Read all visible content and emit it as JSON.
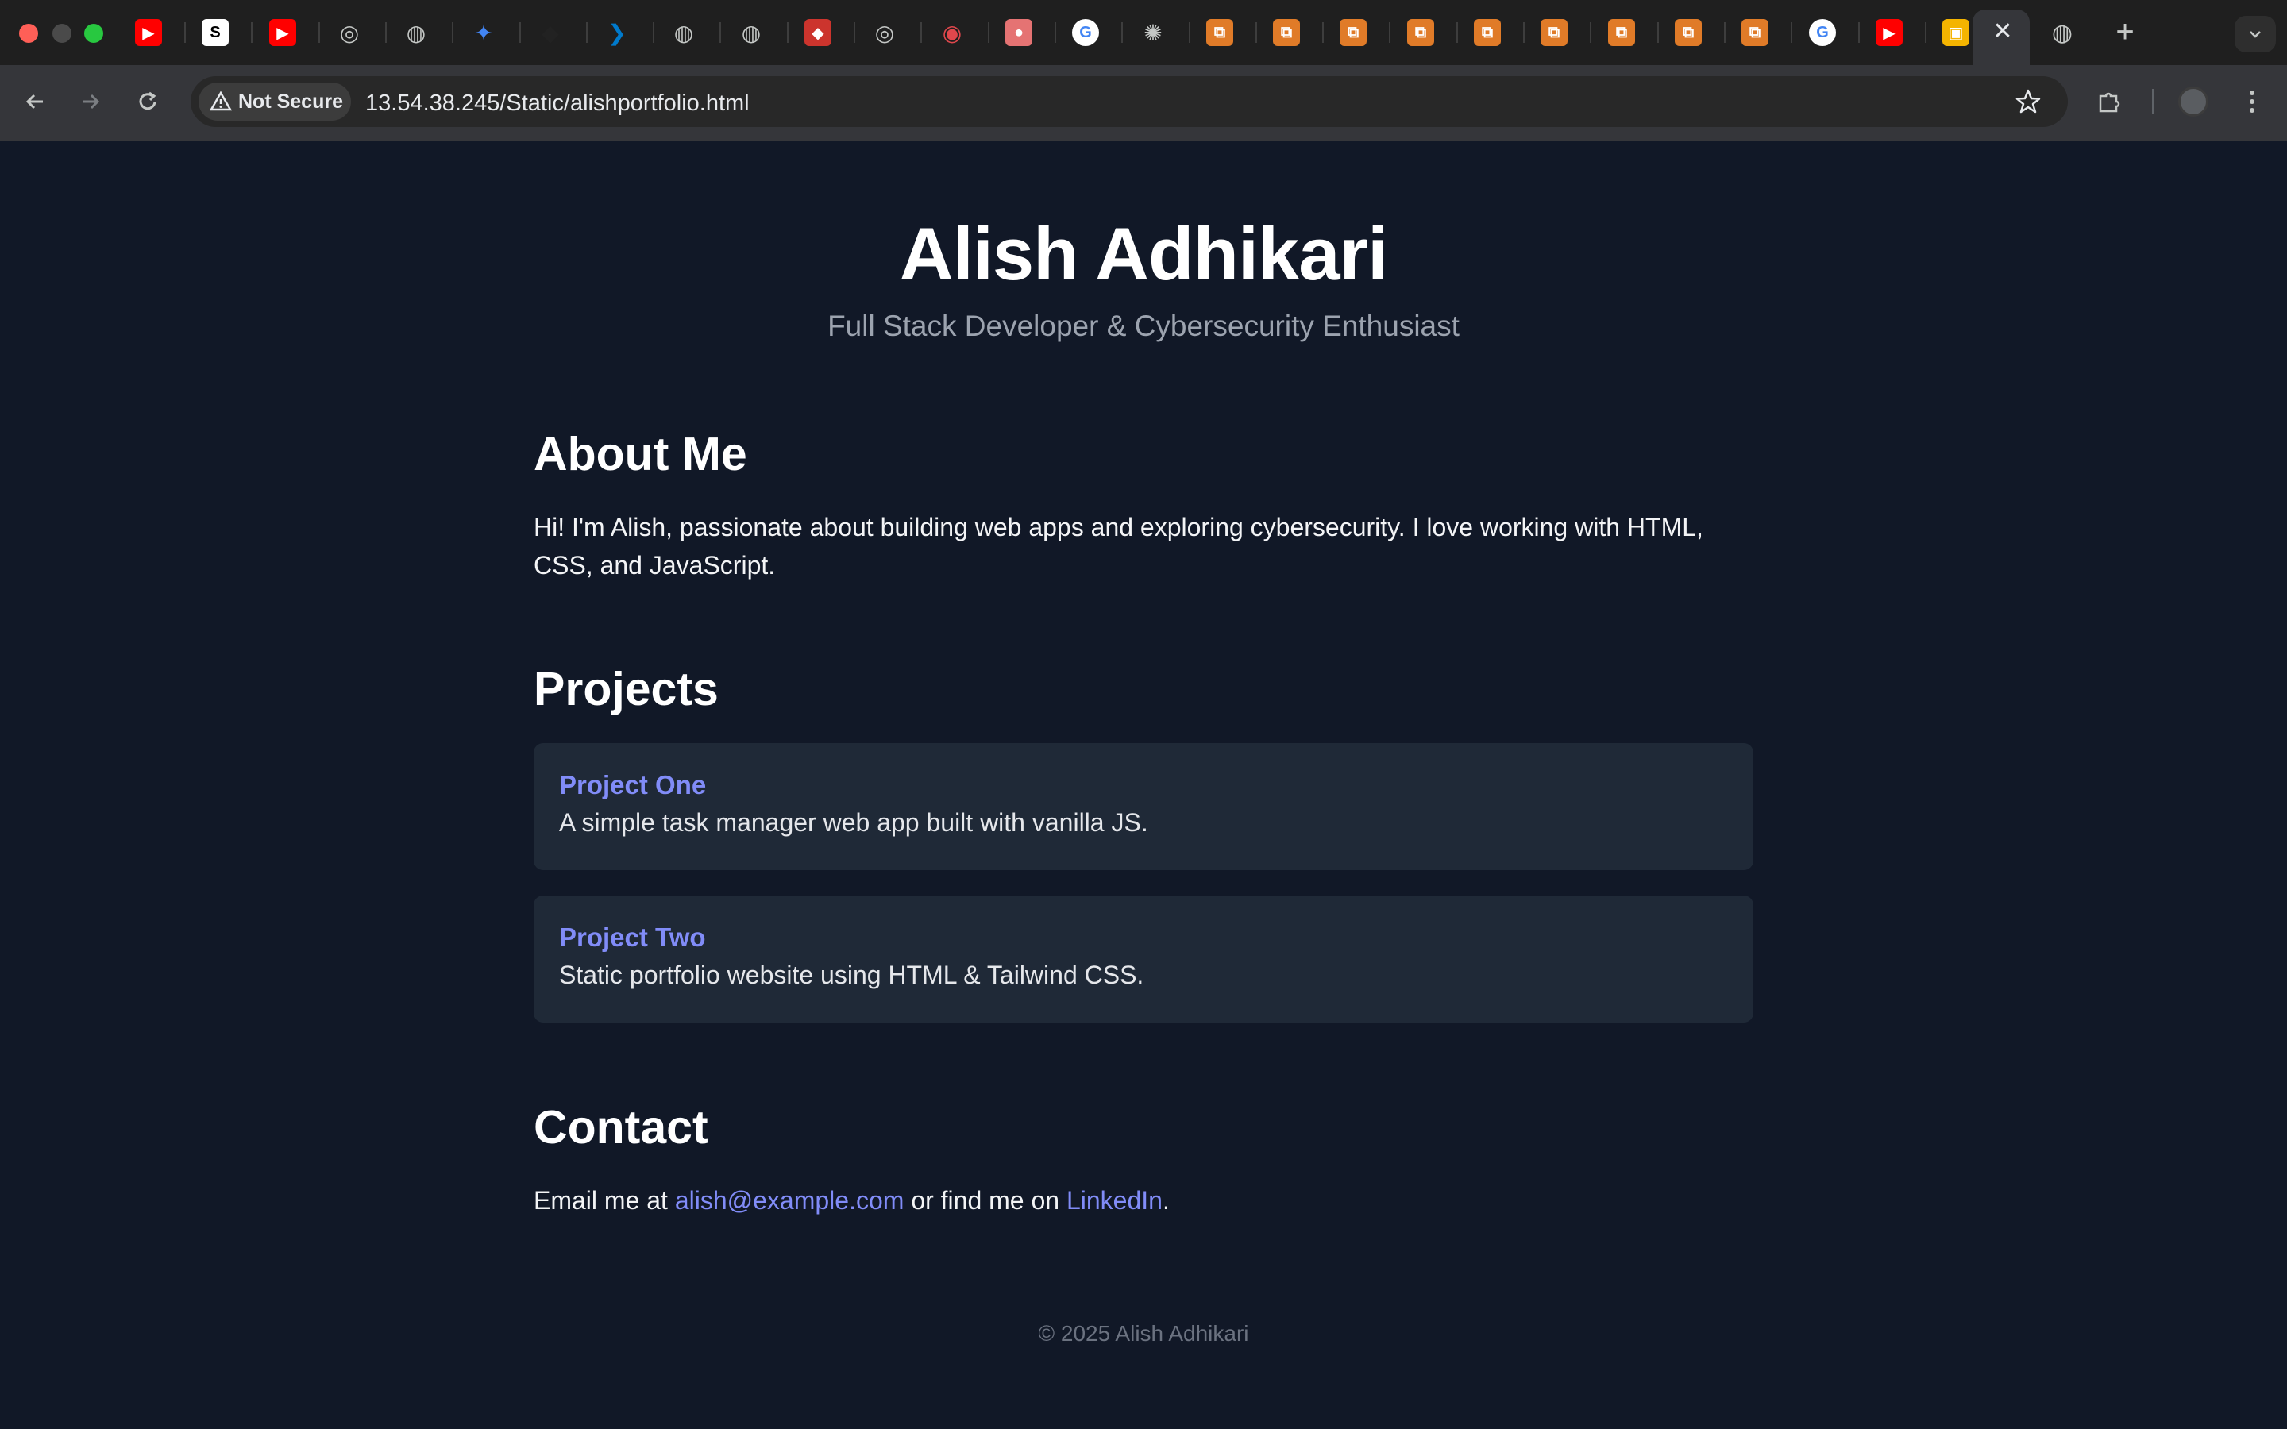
{
  "browser": {
    "tabs": [
      {
        "icon": "youtube-icon",
        "color": "#ff0000",
        "glyph": "▶"
      },
      {
        "icon": "s-logo-icon",
        "color": "#000000",
        "glyph": "S"
      },
      {
        "icon": "youtube-icon",
        "color": "#ff0000",
        "glyph": "▶"
      },
      {
        "icon": "chrome-icon",
        "color": "#5f6368",
        "glyph": "◎"
      },
      {
        "icon": "globe-icon",
        "color": "#5f6368",
        "glyph": "◍"
      },
      {
        "icon": "gemini-icon",
        "color": "#4285f4",
        "glyph": "✦"
      },
      {
        "icon": "game-icon",
        "color": "#222222",
        "glyph": "◆"
      },
      {
        "icon": "vscode-icon",
        "color": "#007acc",
        "glyph": "❯"
      },
      {
        "icon": "globe-icon",
        "color": "#5f6368",
        "glyph": "◍"
      },
      {
        "icon": "globe-icon",
        "color": "#5f6368",
        "glyph": "◍"
      },
      {
        "icon": "ruby-icon",
        "color": "#cc342d",
        "glyph": "◆"
      },
      {
        "icon": "chrome-icon",
        "color": "#5f6368",
        "glyph": "◎"
      },
      {
        "icon": "anaconda-icon",
        "color": "#e0474c",
        "glyph": "◉"
      },
      {
        "icon": "app-icon",
        "color": "#e57373",
        "glyph": "●"
      },
      {
        "icon": "google-icon",
        "color": "#ffffff",
        "glyph": "G"
      },
      {
        "icon": "openai-icon",
        "color": "#5f6368",
        "glyph": "✺"
      },
      {
        "icon": "aws-icon",
        "color": "#e07b28",
        "glyph": "⧉"
      },
      {
        "icon": "aws-icon",
        "color": "#e07b28",
        "glyph": "⧉"
      },
      {
        "icon": "aws-icon",
        "color": "#e07b28",
        "glyph": "⧉"
      },
      {
        "icon": "aws-icon",
        "color": "#e07b28",
        "glyph": "⧉"
      },
      {
        "icon": "aws-icon",
        "color": "#e07b28",
        "glyph": "⧉"
      },
      {
        "icon": "aws-icon",
        "color": "#e07b28",
        "glyph": "⧉"
      },
      {
        "icon": "aws-icon",
        "color": "#e07b28",
        "glyph": "⧉"
      },
      {
        "icon": "aws-icon",
        "color": "#e07b28",
        "glyph": "⧉"
      },
      {
        "icon": "aws-icon",
        "color": "#e07b28",
        "glyph": "⧉"
      },
      {
        "icon": "google-icon",
        "color": "#ffffff",
        "glyph": "G"
      },
      {
        "icon": "youtube-icon",
        "color": "#ff0000",
        "glyph": "▶"
      },
      {
        "icon": "package-icon",
        "color": "#f4b400",
        "glyph": "▣"
      }
    ],
    "active_tab_close": "✕",
    "inactive_tab_after": {
      "icon": "globe-icon",
      "glyph": "◍"
    },
    "new_tab": "+",
    "security_label": "Not Secure",
    "url": "13.54.38.245/Static/alishportfolio.html"
  },
  "hero": {
    "name": "Alish Adhikari",
    "tagline": "Full Stack Developer & Cybersecurity Enthusiast"
  },
  "about": {
    "title": "About Me",
    "line1": "Hi! I'm Alish, passionate about building web apps and exploring cybersecurity. I love working with HTML,",
    "line2": "CSS, and JavaScript."
  },
  "projects": {
    "title": "Projects",
    "items": [
      {
        "name": "Project One",
        "description": "A simple task manager web app built with vanilla JS."
      },
      {
        "name": "Project Two",
        "description": "Static portfolio website using HTML & Tailwind CSS."
      }
    ]
  },
  "contact": {
    "title": "Contact",
    "prefix": "Email me at ",
    "email": "alish@example.com",
    "middle": " or find me on ",
    "linkedin": "LinkedIn",
    "suffix": "."
  },
  "footer": {
    "text": "© 2025 Alish Adhikari"
  }
}
